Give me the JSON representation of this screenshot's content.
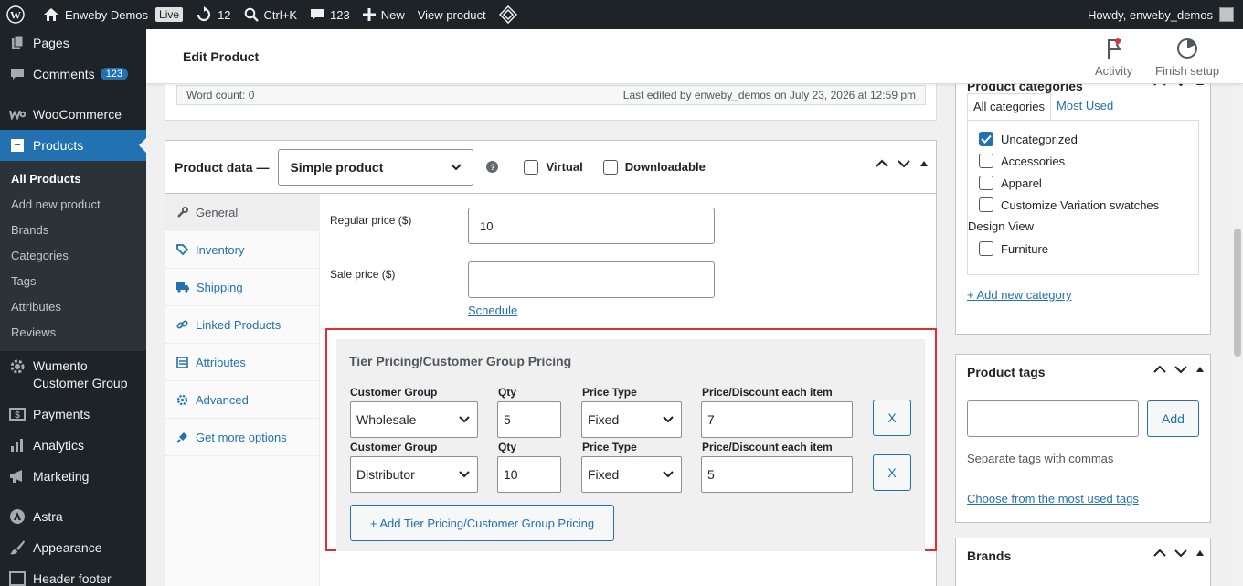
{
  "admin_bar": {
    "site_name": "Enweby Demos",
    "live_label": "Live",
    "updates_count": "12",
    "search_shortcut": "Ctrl+K",
    "comments_count": "123",
    "new_label": "New",
    "view_product_label": "View product",
    "greeting": "Howdy, enweby_demos"
  },
  "sidebar": {
    "pages": "Pages",
    "comments": "Comments",
    "comments_badge": "123",
    "woocommerce": "WooCommerce",
    "products": "Products",
    "submenu": [
      "All Products",
      "Add new product",
      "Brands",
      "Categories",
      "Tags",
      "Attributes",
      "Reviews"
    ],
    "wumento_line1": "Wumento",
    "wumento_line2": "Customer Group",
    "payments": "Payments",
    "analytics": "Analytics",
    "marketing": "Marketing",
    "astra": "Astra",
    "appearance": "Appearance",
    "header_footer": "Header footer"
  },
  "header": {
    "title": "Edit Product",
    "activity": "Activity",
    "finish_setup": "Finish setup"
  },
  "editor": {
    "word_count": "Word count: 0",
    "last_edited": "Last edited by enweby_demos on July 23, 2026 at 12:59 pm"
  },
  "product_data": {
    "title": "Product data —",
    "type_selected": "Simple product",
    "help": "?",
    "virtual_label": "Virtual",
    "downloadable_label": "Downloadable",
    "tabs": [
      "General",
      "Inventory",
      "Shipping",
      "Linked Products",
      "Attributes",
      "Advanced",
      "Get more options"
    ],
    "regular_price_label": "Regular price ($)",
    "regular_price_value": "10",
    "sale_price_label": "Sale price ($)",
    "sale_price_value": "",
    "schedule_link": "Schedule"
  },
  "tier_pricing": {
    "title": "Tier Pricing/Customer Group Pricing",
    "col_group": "Customer Group",
    "col_qty": "Qty",
    "col_price_type": "Price Type",
    "col_discount": "Price/Discount each item",
    "rows": [
      {
        "group": "Wholesale",
        "qty": "5",
        "price_type": "Fixed",
        "discount": "7",
        "remove": "X"
      },
      {
        "group": "Distributor",
        "qty": "10",
        "price_type": "Fixed",
        "discount": "5",
        "remove": "X"
      }
    ],
    "add_button": "+ Add Tier Pricing/Customer Group Pricing"
  },
  "categories": {
    "title": "Product categories",
    "tab_all": "All categories",
    "tab_most_used": "Most Used",
    "items": [
      {
        "label": "Uncategorized",
        "checked": true
      },
      {
        "label": "Accessories",
        "checked": false
      },
      {
        "label": "Apparel",
        "checked": false
      },
      {
        "label": "Customize Variation swatches",
        "checked": false
      }
    ],
    "group_label": "Design View",
    "furniture": "Furniture",
    "add_new": "+ Add new category"
  },
  "tags": {
    "title": "Product tags",
    "input_value": "",
    "add_button": "Add",
    "hint": "Separate tags with commas",
    "choose_link": "Choose from the most used tags"
  },
  "brands": {
    "title": "Brands"
  },
  "colors": {
    "accent": "#2271b1",
    "admin_dark": "#1d2327",
    "highlight_outline": "#e02f2f"
  }
}
